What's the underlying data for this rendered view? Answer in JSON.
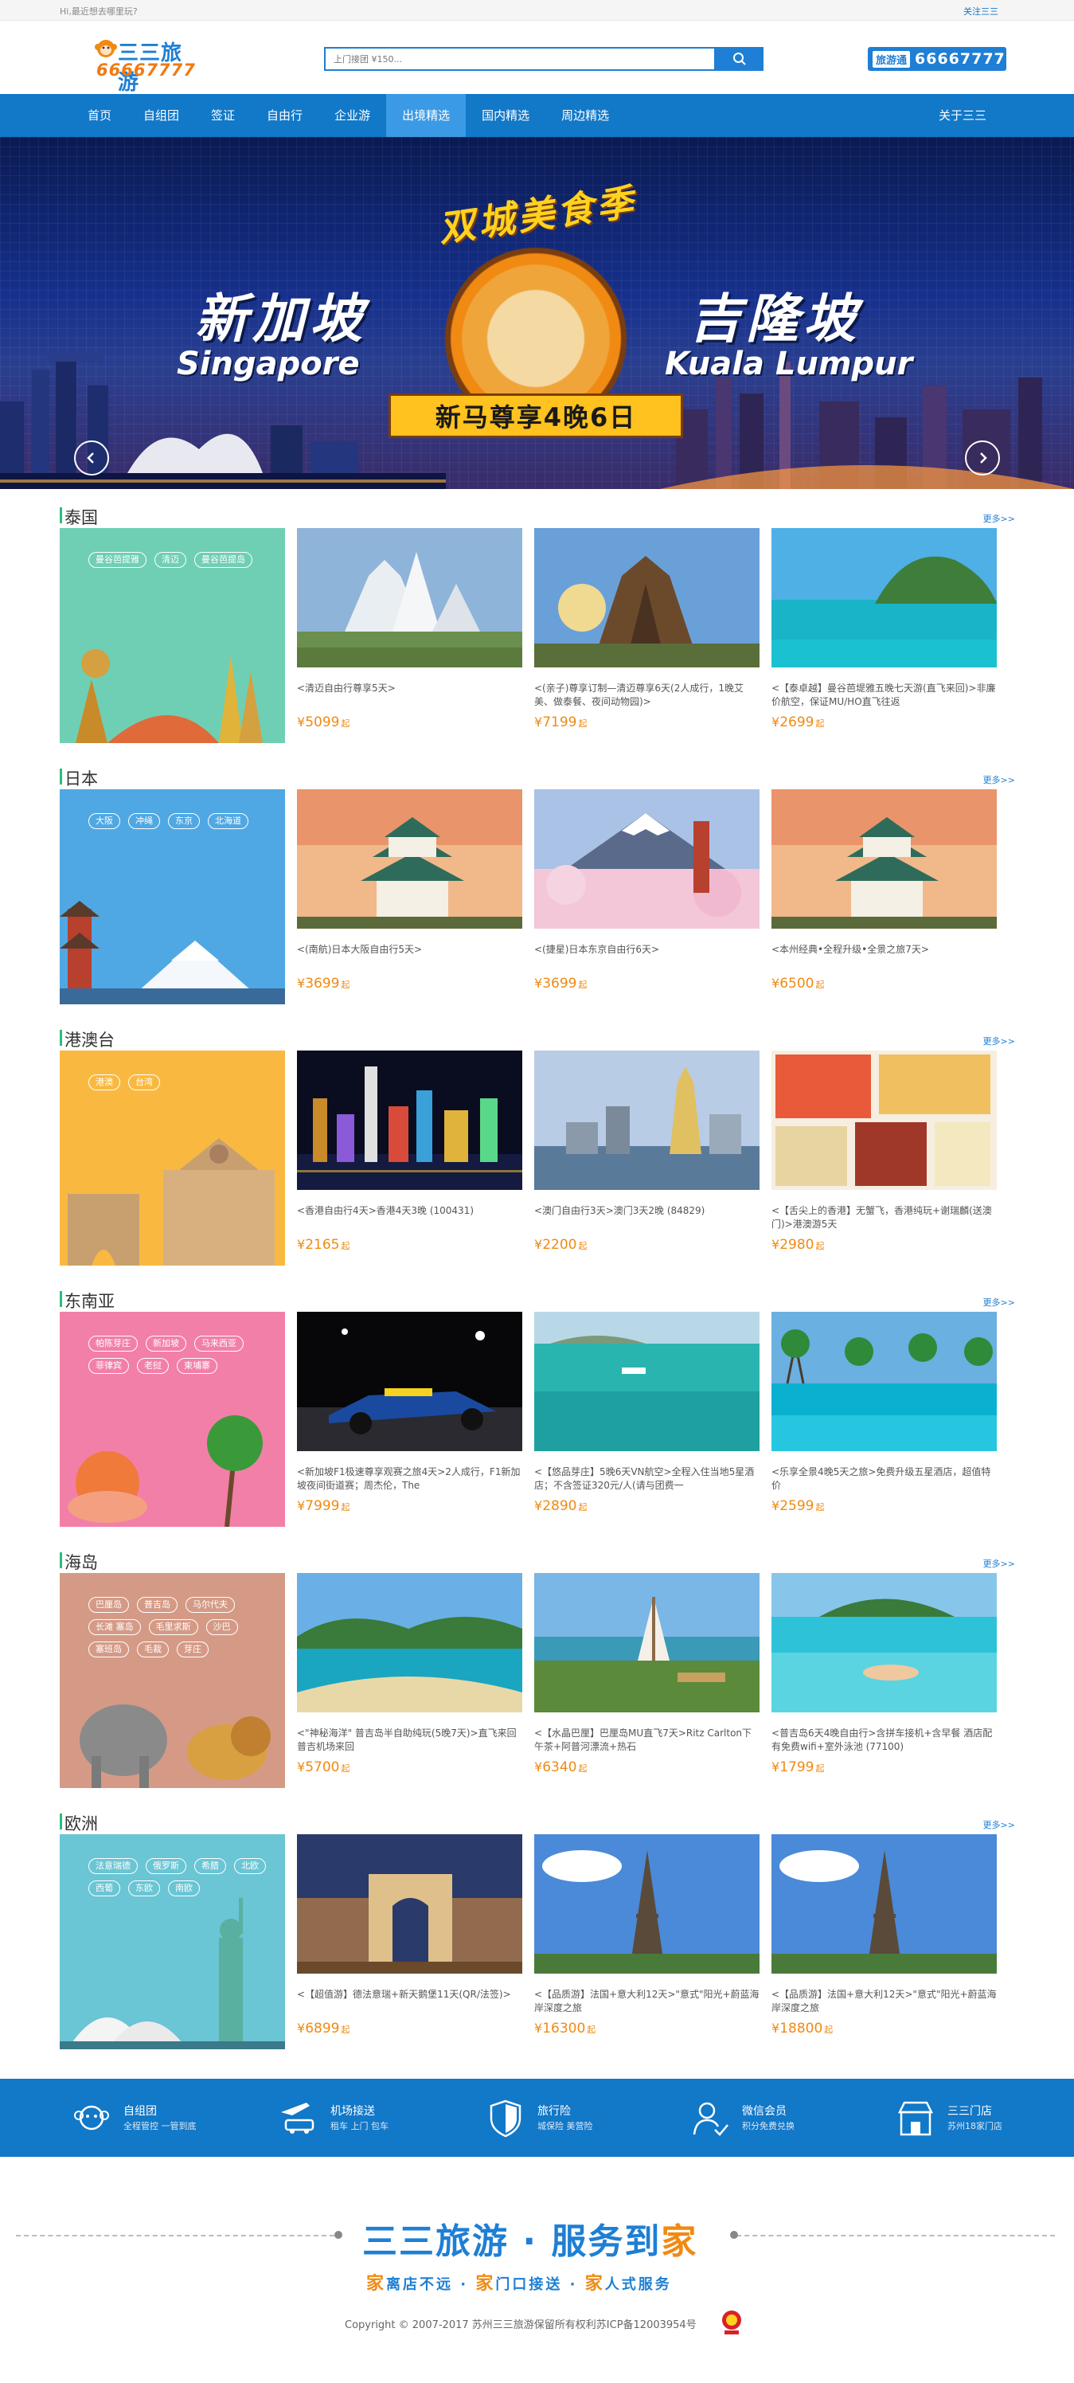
{
  "topbar": {
    "greeting": "Hi,最近想去哪里玩?",
    "follow": "关注三三"
  },
  "brand": {
    "name": "三三旅游",
    "phone": "66667777"
  },
  "search": {
    "placeholder": "上门接团 ¥150..."
  },
  "hotline": {
    "label": "旅游通",
    "number": "66667777"
  },
  "nav": {
    "items": [
      "首页",
      "自组团",
      "签证",
      "自由行",
      "企业游",
      "出境精选",
      "国内精选",
      "周边精选"
    ],
    "active_index": 5,
    "about": "关于三三"
  },
  "banner": {
    "title": "双城美食季",
    "city_left_cn": "新加坡",
    "city_left_en": "Singapore",
    "city_right_cn": "吉隆坡",
    "city_right_en": "Kuala Lumpur",
    "ribbon": "新马尊享4晚6日",
    "slides": 3,
    "active_slide": 1
  },
  "more_label": "更多>>",
  "sections": [
    {
      "title": "泰国",
      "promo_color": "#6fcfb4",
      "tags": [
        "曼谷芭提雅",
        "清迈",
        "曼谷芭提岛"
      ],
      "cards": [
        {
          "desc": "<清迈自由行尊享5天>",
          "price": "5099",
          "img": "temple"
        },
        {
          "desc": "<(亲子)尊享订制—清迈尊享6天(2人成行，1晚艾美、做泰餐、夜间动物园)>",
          "price": "7199",
          "img": "ruins"
        },
        {
          "desc": "<【泰卓越】曼谷芭堤雅五晚七天游(直飞来回)>非廉价航空，保证MU/HO直飞往返",
          "price": "2699",
          "img": "island"
        }
      ]
    },
    {
      "title": "日本",
      "promo_color": "#4fa8e3",
      "tags": [
        "大阪",
        "冲绳",
        "东京",
        "北海道"
      ],
      "cards": [
        {
          "desc": "<(南航)日本大阪自由行5天>",
          "price": "3699",
          "img": "castle"
        },
        {
          "desc": "<(捷星)日本东京自由行6天>",
          "price": "3699",
          "img": "fuji"
        },
        {
          "desc": "<本州经典•全程升级•全景之旅7天>",
          "price": "6500",
          "img": "castle"
        }
      ]
    },
    {
      "title": "港澳台",
      "promo_color": "#f9b940",
      "tags": [
        "港澳",
        "台湾"
      ],
      "cards": [
        {
          "desc": "<香港自由行4天>香港4天3晚 (100431)",
          "price": "2165",
          "img": "hknight"
        },
        {
          "desc": "<澳门自由行3天>澳门3天2晚 (84829)",
          "price": "2200",
          "img": "macau"
        },
        {
          "desc": "<【舌尖上的香港】无蟹飞，香港纯玩+谢瑞麟(送澳门)>港澳游5天",
          "price": "2980",
          "img": "food"
        }
      ]
    },
    {
      "title": "东南亚",
      "promo_color": "#f27fa8",
      "tags": [
        "帕陈芽庄",
        "新加坡",
        "马来西亚",
        "菲律宾",
        "老挝",
        "柬埔寨"
      ],
      "cards": [
        {
          "desc": "<新加坡F1极速尊享观赛之旅4天>2人成行，F1新加坡夜间街道赛；周杰伦，The",
          "price": "7999",
          "img": "f1"
        },
        {
          "desc": "<【悠品芽庄】5晚6天VN航空>全程入住当地5星酒店；不含签证320元/人(请与团费一",
          "price": "2890",
          "img": "sea"
        },
        {
          "desc": "<乐享全景4晚5天之旅>免费升级五星酒店，超值特价",
          "price": "2599",
          "img": "resort"
        }
      ]
    },
    {
      "title": "海岛",
      "promo_color": "#d59a86",
      "tags": [
        "巴厘岛",
        "普吉岛",
        "马尔代夫",
        "长滩 塞岛",
        "毛里求斯",
        "沙巴",
        "塞班岛",
        "毛裁",
        "芽庄"
      ],
      "cards": [
        {
          "desc": "<\"神秘海洋\" 普吉岛半自助纯玩(5晚7天)>直飞来回 普吉机场来回",
          "price": "5700",
          "img": "bay"
        },
        {
          "desc": "<【水晶巴厘】巴厘岛MU直飞7天>Ritz Carlton下午茶+阿普河漂流+热石",
          "price": "6340",
          "img": "beach"
        },
        {
          "desc": "<普吉岛6天4晚自由行>含拼车接机+含早餐 酒店配有免费wifi+室外泳池 (77100)",
          "price": "1799",
          "img": "snorkel"
        }
      ]
    },
    {
      "title": "欧洲",
      "promo_color": "#6ac5d4",
      "tags": [
        "法意瑞德",
        "俄罗斯",
        "希腊",
        "北欧",
        "西葡",
        "东欧",
        "南欧"
      ],
      "cards": [
        {
          "desc": "<【超值游】德法意瑞+新天鹅堡11天(QR/法签)>",
          "price": "6899",
          "img": "arch"
        },
        {
          "desc": "<【品质游】法国+意大利12天>\"意式\"阳光+蔚蓝海岸深度之旅",
          "price": "16300",
          "img": "eiffel"
        },
        {
          "desc": "<【品质游】法国+意大利12天>\"意式\"阳光+蔚蓝海岸深度之旅",
          "price": "18800",
          "img": "eiffel"
        }
      ]
    }
  ],
  "price_prefix": "¥",
  "price_suffix": "起",
  "services": [
    {
      "title": "自组团",
      "sub": "全程管控 一管到底",
      "icon": "monkey-icon"
    },
    {
      "title": "机场接送",
      "sub": "租车 上门 包车",
      "icon": "plane-car-icon"
    },
    {
      "title": "旅行险",
      "sub": "城保险 美营险",
      "icon": "shield-icon"
    },
    {
      "title": "微信会员",
      "sub": "积分免费兑换",
      "icon": "wechat-member-icon"
    },
    {
      "title": "三三门店",
      "sub": "苏州18家门店",
      "icon": "store-icon"
    }
  ],
  "footer": {
    "slogan_main": "三三旅游 · 服务到",
    "slogan_small": "到",
    "slogan_home": "家",
    "sub_parts": [
      "家",
      "离店不远 · ",
      "家",
      "门口接送 · ",
      "家",
      "人式服务"
    ],
    "copyright": "Copyright © 2007-2017 苏州三三旅游保留所有权利苏ICP备12003954号"
  },
  "colors": {
    "primary": "#1278c8",
    "accent": "#f08a12",
    "section_bar": "#2bbd7e"
  }
}
